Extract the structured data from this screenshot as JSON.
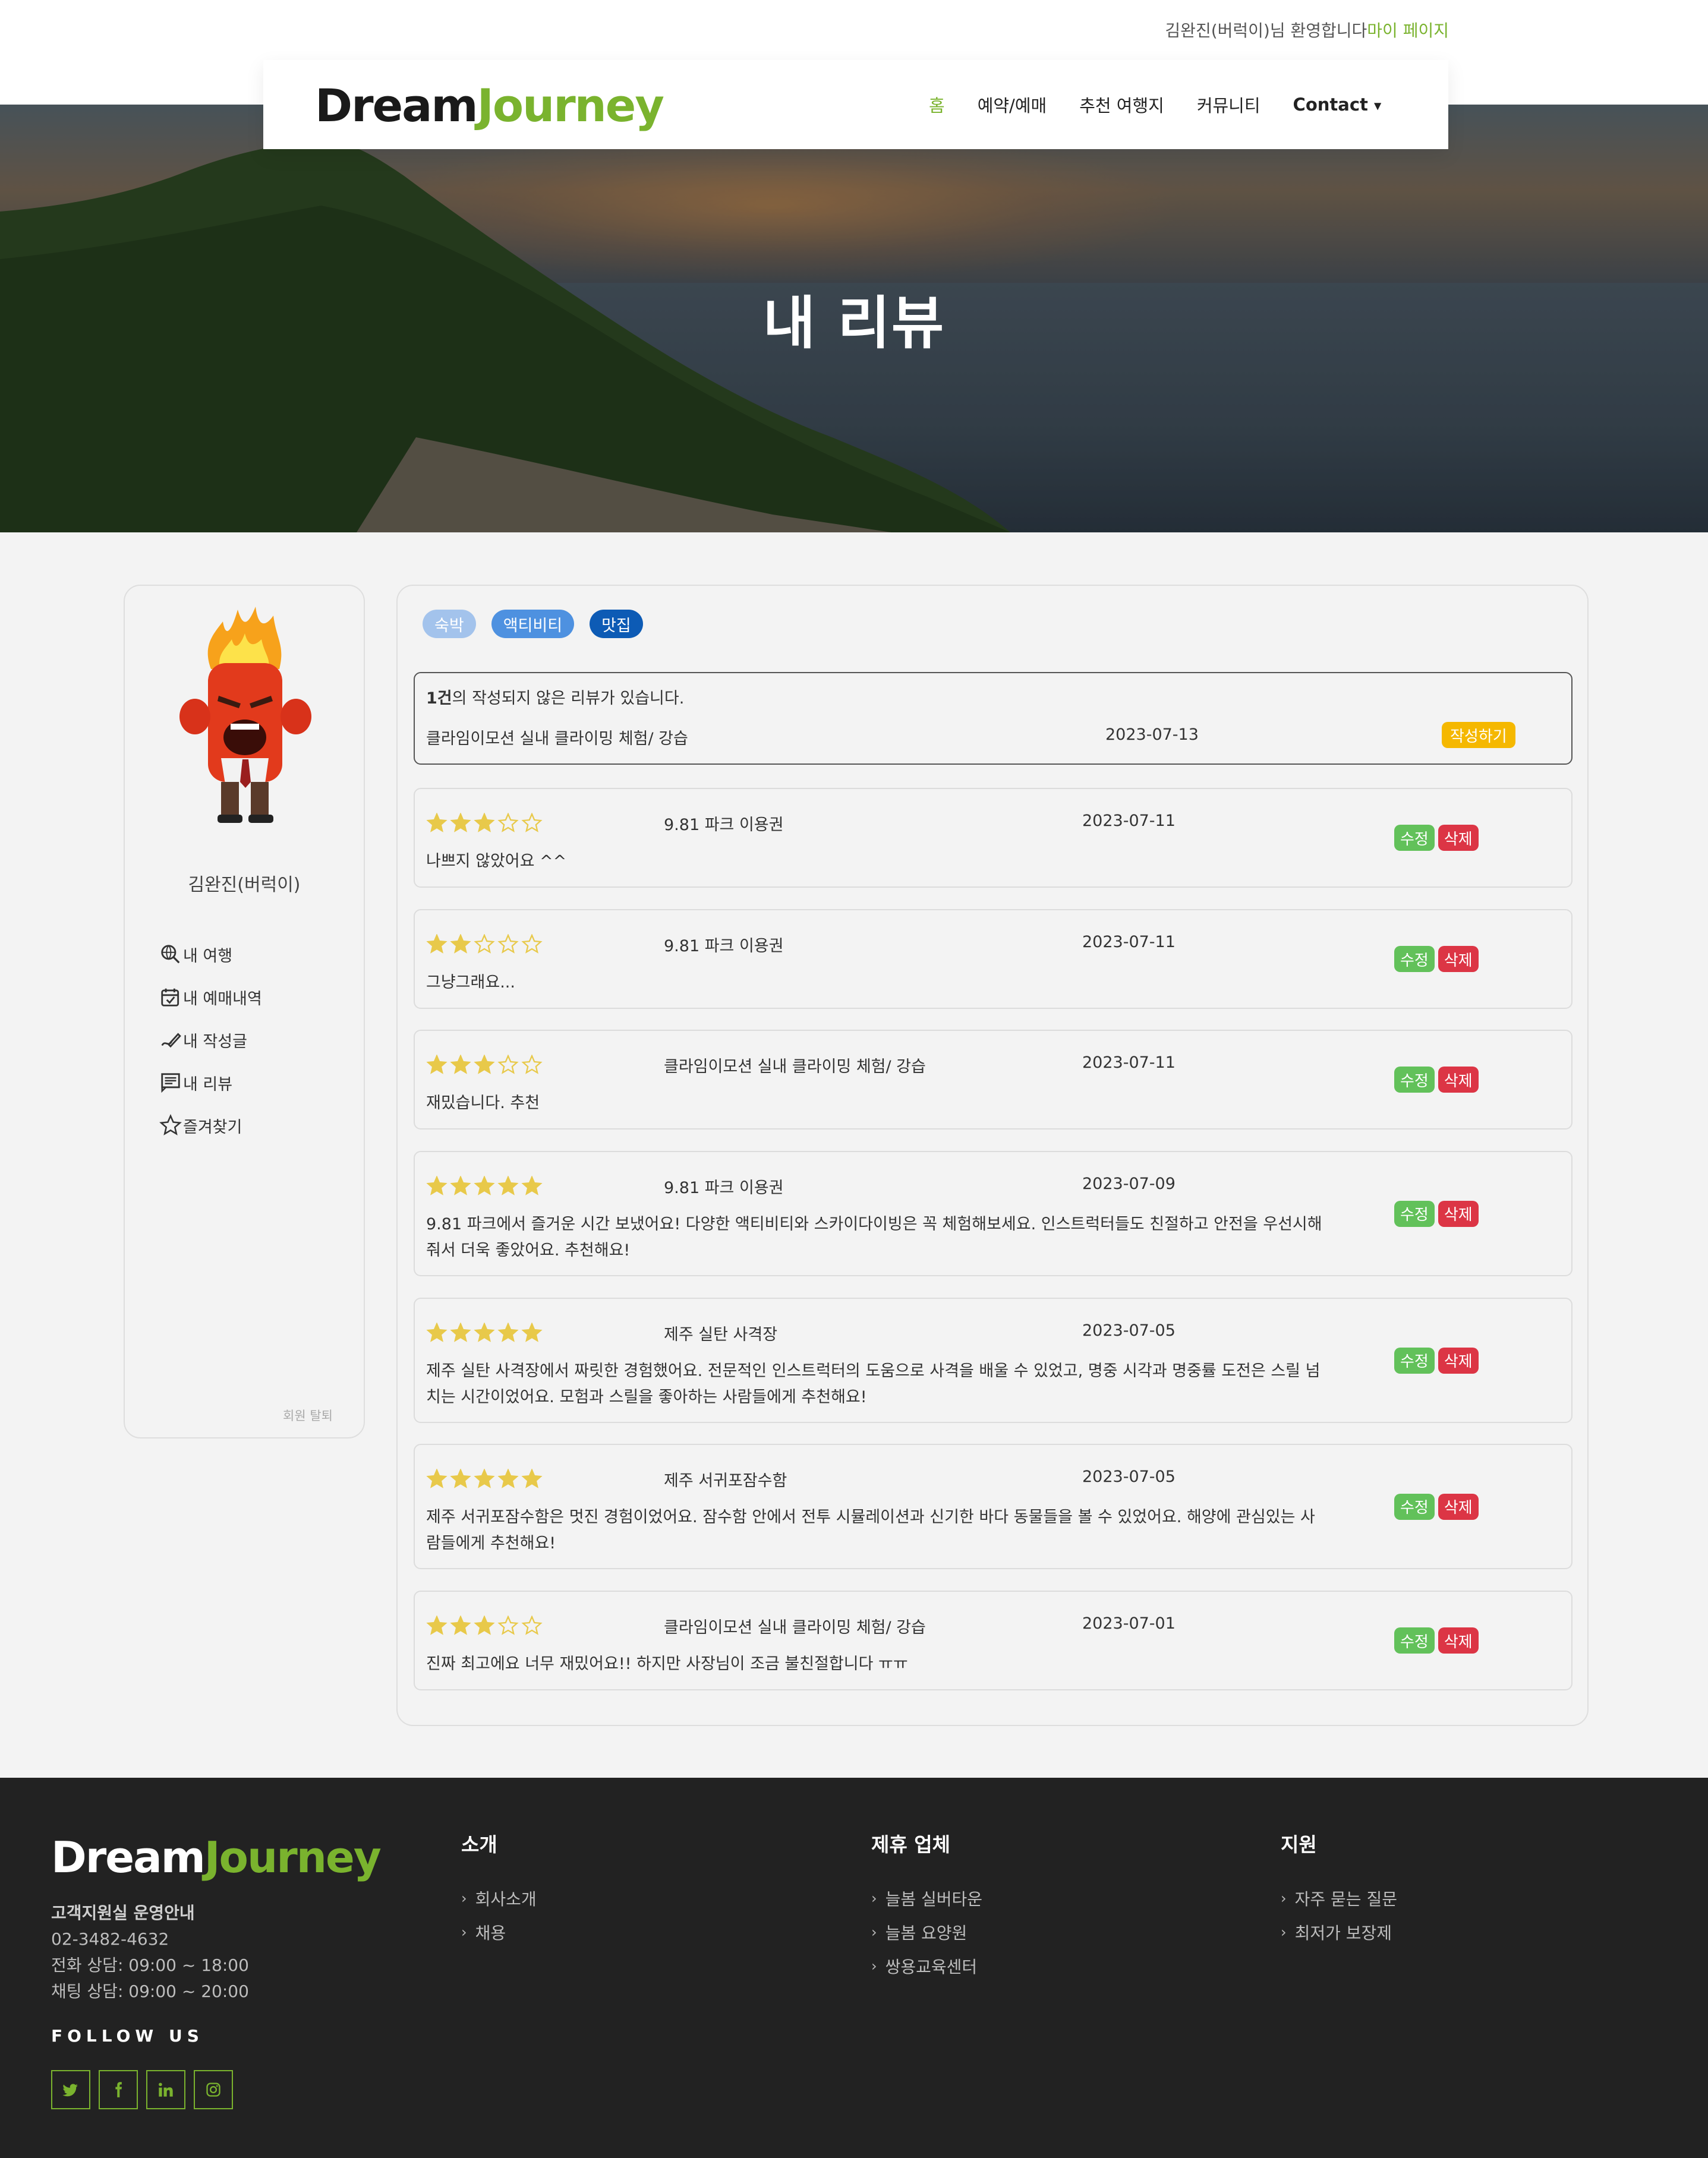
{
  "header": {
    "welcome_text": "김완진(버럭이)님 환영합니다",
    "mypage_link": "마이 페이지",
    "logo_dream": "Dream",
    "logo_journey": "Journey",
    "nav": [
      "홈",
      "예약/예매",
      "추천 여행지",
      "커뮤니티",
      "Contact"
    ]
  },
  "hero": {
    "title": "내 리뷰"
  },
  "sidebar": {
    "username": "김완진(버럭이)",
    "menu": [
      "내 여행",
      "내 예매내역",
      "내 작성글",
      "내 리뷰",
      "즐겨찾기"
    ],
    "withdraw": "회원 탈퇴"
  },
  "filters": [
    "숙박",
    "액티비티",
    "맛집"
  ],
  "pending": {
    "count": "1건",
    "message": "의 작성되지 않은 리뷰가 있습니다.",
    "name": "클라임이모션 실내 클라이밍 체험/ 강습",
    "date": "2023-07-13",
    "button": "작성하기"
  },
  "buttons": {
    "edit": "수정",
    "delete": "삭제"
  },
  "reviews": [
    {
      "rating": 3,
      "name": "9.81 파크 이용권",
      "date": "2023-07-11",
      "text": "나쁘지 않았어요 ^^"
    },
    {
      "rating": 2,
      "name": "9.81 파크 이용권",
      "date": "2023-07-11",
      "text": "그냥그래요..."
    },
    {
      "rating": 3,
      "name": "클라임이모션 실내 클라이밍 체험/ 강습",
      "date": "2023-07-11",
      "text": "재밌습니다. 추천"
    },
    {
      "rating": 5,
      "name": "9.81 파크 이용권",
      "date": "2023-07-09",
      "text": "9.81 파크에서 즐거운 시간 보냈어요! 다양한 액티비티와 스카이다이빙은 꼭 체험해보세요. 인스트럭터들도 친절하고 안전을 우선시해줘서 더욱 좋았어요. 추천해요!"
    },
    {
      "rating": 5,
      "name": "제주 실탄 사격장",
      "date": "2023-07-05",
      "text": "제주 실탄 사격장에서 짜릿한 경험했어요. 전문적인 인스트럭터의 도움으로 사격을 배울 수 있었고, 명중 시각과 명중률 도전은 스릴 넘치는 시간이었어요. 모험과 스릴을 좋아하는 사람들에게 추천해요!"
    },
    {
      "rating": 5,
      "name": "제주 서귀포잠수함",
      "date": "2023-07-05",
      "text": "제주 서귀포잠수함은 멋진 경험이었어요. 잠수함 안에서 전투 시뮬레이션과 신기한 바다 동물들을 볼 수 있었어요. 해양에 관심있는 사람들에게 추천해요!"
    },
    {
      "rating": 3,
      "name": "클라임이모션 실내 클라이밍 체험/ 강습",
      "date": "2023-07-01",
      "text": "진짜 최고에요 너무 재밌어요!! 하지만 사장님이 조금 불친절합니다 ㅠㅠ"
    }
  ],
  "footer": {
    "logo_dream": "Dream",
    "logo_journey": "Journey",
    "support_title": "고객지원실 운영안내",
    "phone": "02-3482-4632",
    "call_hours": "전화 상담: 09:00 ~ 18:00",
    "chat_hours": "채팅 상담: 09:00 ~ 20:00",
    "follow": "FOLLOW US",
    "columns": [
      {
        "title": "소개",
        "links": [
          "회사소개",
          "채용"
        ]
      },
      {
        "title": "제휴 업체",
        "links": [
          "늘봄 실버타운",
          "늘봄 요양원",
          "쌍용교육센터"
        ]
      },
      {
        "title": "지원",
        "links": [
          "자주 묻는 질문",
          "최저가 보장제"
        ]
      }
    ]
  },
  "colors": {
    "brand_green": "#7ab32e",
    "edit": "#62c15a",
    "delete": "#dc3545",
    "write": "#f5b800",
    "star": "#e8c94a"
  }
}
